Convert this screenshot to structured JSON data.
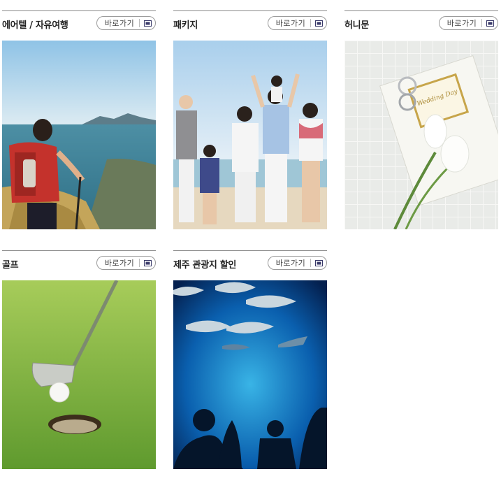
{
  "cards": [
    {
      "title": "에어텔 / 자유여행",
      "button": "바로가기",
      "image": "hiker-seaside-photo",
      "link_icon": "new-window-icon"
    },
    {
      "title": "패키지",
      "button": "바로가기",
      "image": "family-beach-photo",
      "link_icon": "new-window-icon"
    },
    {
      "title": "허니문",
      "button": "바로가기",
      "image": "wedding-rings-invitation-photo",
      "image_text": "Wedding Day",
      "link_icon": "new-window-icon"
    },
    {
      "title": "골프",
      "button": "바로가기",
      "image": "golf-putter-ball-photo",
      "link_icon": "new-window-icon"
    },
    {
      "title": "제주 관광지 할인",
      "button": "바로가기",
      "image": "aquarium-fish-photo",
      "link_icon": "new-window-icon"
    }
  ],
  "colors": {
    "title": "#222222",
    "border": "#8a8a8a",
    "button_border": "#9a9a9a",
    "icon": "#3a3a6a"
  }
}
